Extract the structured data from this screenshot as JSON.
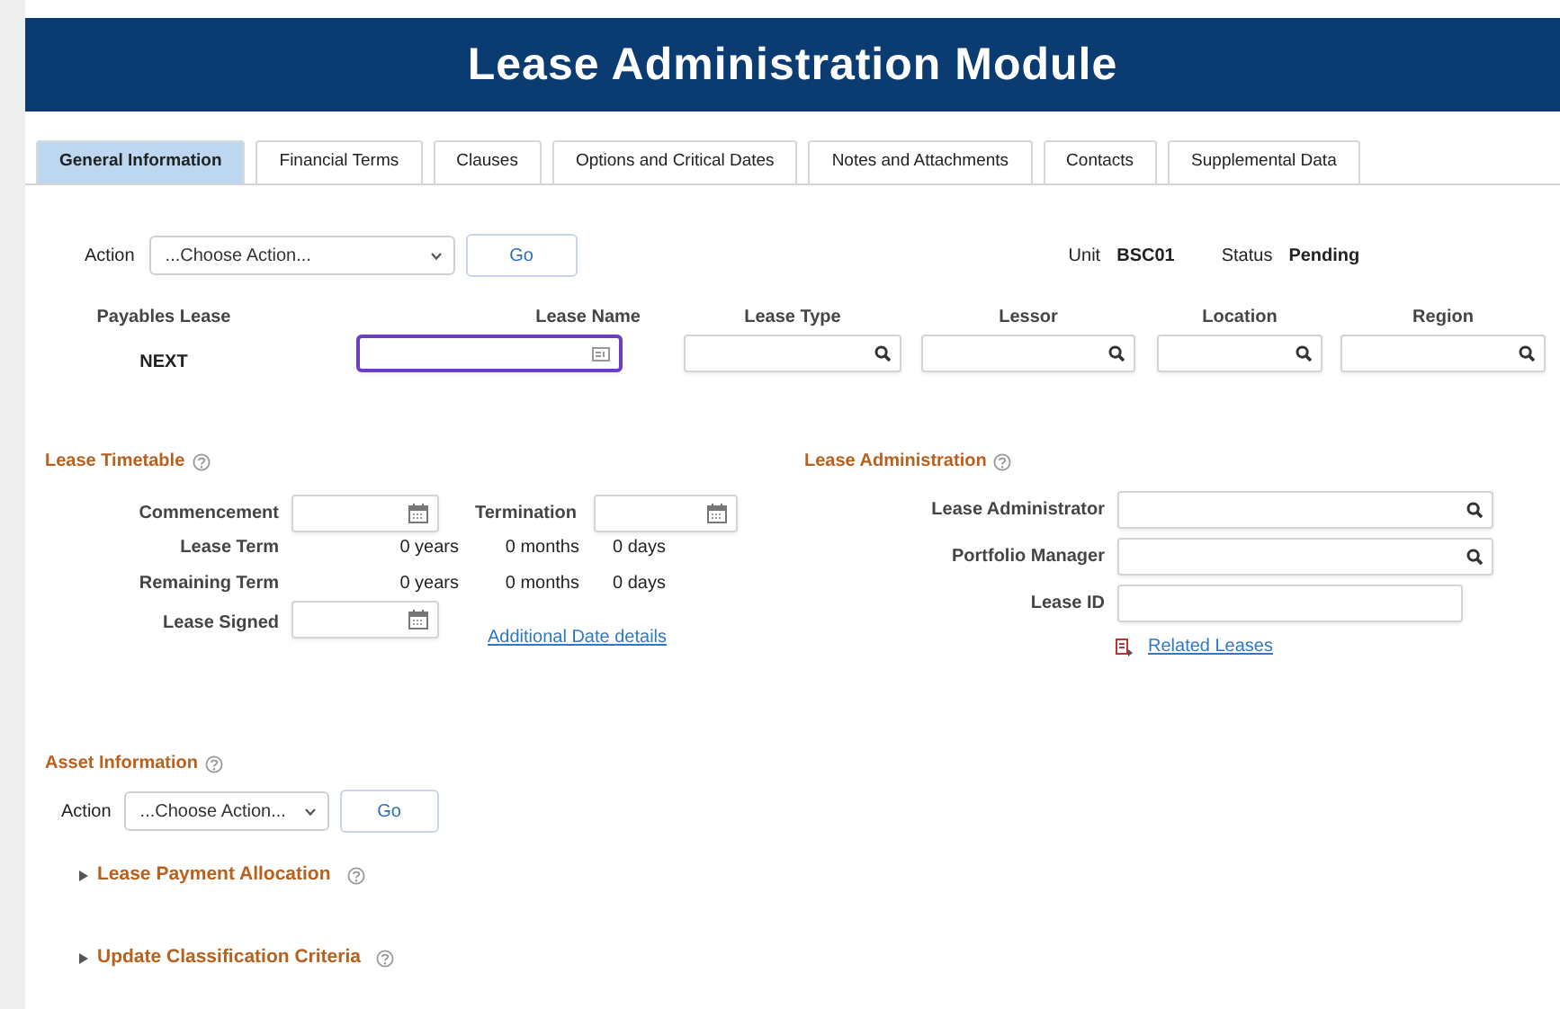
{
  "header": {
    "title": "Lease Administration Module"
  },
  "tabs": [
    {
      "label": "General Information",
      "selected": true
    },
    {
      "label": "Financial Terms",
      "selected": false
    },
    {
      "label": "Clauses",
      "selected": false
    },
    {
      "label": "Options and Critical Dates",
      "selected": false
    },
    {
      "label": "Notes and Attachments",
      "selected": false
    },
    {
      "label": "Contacts",
      "selected": false
    },
    {
      "label": "Supplemental Data",
      "selected": false
    }
  ],
  "action_bar": {
    "label": "Action",
    "select": "...Choose Action...",
    "button": "Go"
  },
  "info": [
    {
      "label": "Unit",
      "value": "BSC01"
    },
    {
      "label": "Status",
      "value": "Pending"
    }
  ],
  "lease_fields": [
    {
      "kind": "display",
      "label": "Payables Lease",
      "value": "NEXT"
    },
    {
      "kind": "text",
      "label": "Lease Name",
      "focused": true
    },
    {
      "kind": "lookup",
      "label": "Lease Type",
      "focused": false
    },
    {
      "kind": "lookup",
      "label": "Lessor",
      "focused": false
    },
    {
      "kind": "lookup",
      "label": "Location",
      "focused": false
    },
    {
      "kind": "lookup",
      "label": "Region",
      "focused": false
    }
  ],
  "lease_timetable": {
    "title": "Lease Timetable",
    "dates": [
      {
        "label": "Commencement"
      },
      {
        "label": "Termination"
      }
    ],
    "terms": [
      {
        "label": "Lease Term",
        "values": [
          "0 years",
          "0 months",
          "0 days"
        ]
      },
      {
        "label": "Remaining Term",
        "values": [
          "0 years",
          "0 months",
          "0 days"
        ]
      }
    ],
    "signed": {
      "label": "Lease Signed"
    },
    "link": "Additional Date details"
  },
  "lease_administration": {
    "title": "Lease Administration",
    "fields": [
      {
        "kind": "lookup",
        "label": "Lease Administrator"
      },
      {
        "kind": "lookup",
        "label": "Portfolio Manager"
      },
      {
        "kind": "text",
        "label": "Lease ID"
      }
    ],
    "link": "Related Leases"
  },
  "asset_information": {
    "title": "Asset Information",
    "action_bar": {
      "label": "Action",
      "select": "...Choose Action...",
      "button": "Go"
    },
    "collapsibles": [
      {
        "title": "Lease Payment Allocation",
        "expanded": false
      },
      {
        "title": "Update Classification Criteria",
        "expanded": false
      }
    ]
  }
}
